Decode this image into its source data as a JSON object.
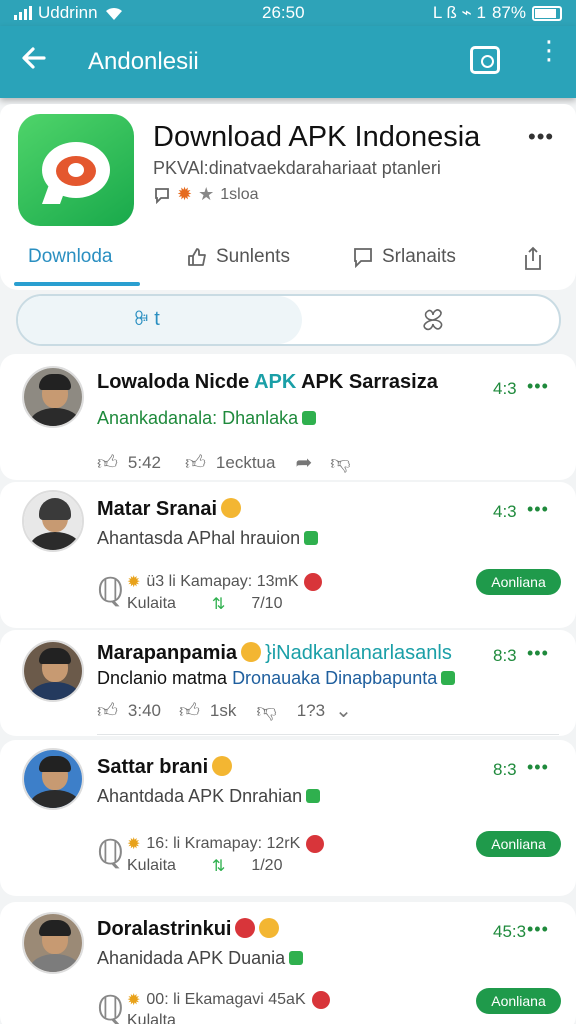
{
  "status": {
    "carrier": "Uddrinn",
    "time": "26:50",
    "right_text": "L ß ⌁ 1",
    "battery": "87%"
  },
  "appbar": {
    "title": "Andonlesii",
    "back_icon": "arrow-left-icon",
    "action_icon": "chat-icon",
    "more_icon": "more-vert-icon"
  },
  "app": {
    "title": "Download APK Indonesia",
    "subtitle": "PKVAl:dinatvaekdarahariaat ptanleri",
    "meta_count": "1sloa"
  },
  "tabs": [
    {
      "label": "Downloda",
      "active": true
    },
    {
      "label": "Sunlents",
      "icon": "thumb-up-icon"
    },
    {
      "label": "Srlanaits",
      "icon": "comment-icon"
    },
    {
      "label": "",
      "icon": "share-icon"
    }
  ],
  "segment": {
    "left_label": "ꔭ t",
    "right_icon": "clover-icon"
  },
  "posts": [
    {
      "name_a": "Lowaloda Nicde ",
      "name_teal": "APK",
      "name_b": " APK Sarrasiza",
      "sub": "Anankadanala: Dhanlaka",
      "time": "4:3",
      "likes": "5:42",
      "shares": "1ecktua"
    },
    {
      "name": "Matar Sranai",
      "sub": "Ahantasda APhal hrauion",
      "time": "4:3",
      "stats1": "ü3 li Kamapay: 13mK",
      "stats2": "Kulaita",
      "stats2b": "7/10",
      "pill": "Aonliana"
    },
    {
      "name": "Marapanpamia",
      "name_teal": "}iNadkanlanarlasanls",
      "sub_a": "Dnclanio matma ",
      "sub_blue": "Dronauaka Dinapbapunta",
      "time": "8:3",
      "likes": "3:40",
      "comments": "1sk",
      "count": "1?3"
    },
    {
      "name": "Sattar brani",
      "sub": "Ahantdada APK Dnrahian",
      "time": "8:3",
      "stats1": "16: li Kramapay: 12rK",
      "stats2": "Kulaita",
      "stats2b": "1/20",
      "pill": "Aonliana"
    },
    {
      "name": "Doralastrinkui",
      "sub": "Ahanidada APK Duania",
      "time": "45:3",
      "stats1": "00: li Ekamagavi 45aK",
      "stats2": "Kulalta",
      "pill": "Aonliana"
    }
  ]
}
